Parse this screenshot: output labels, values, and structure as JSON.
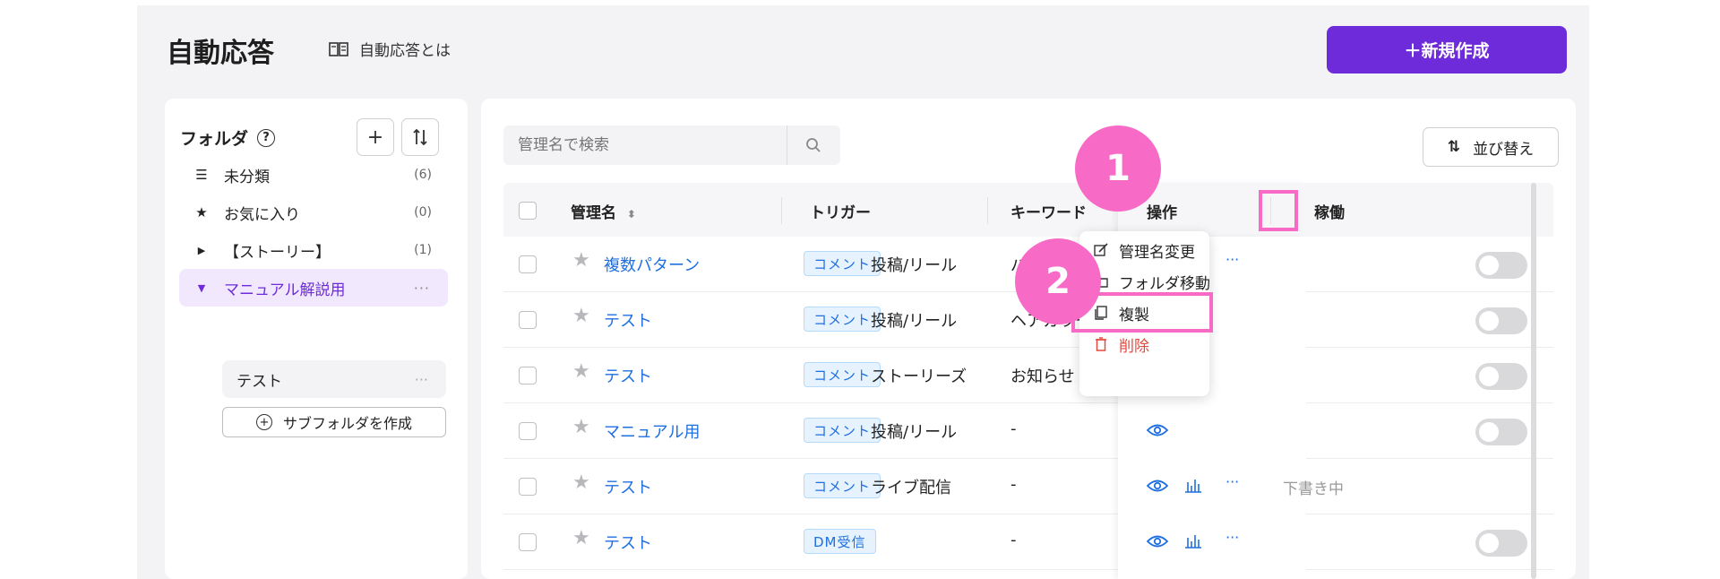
{
  "header": {
    "title": "自動応答",
    "help_link": "自動応答とは",
    "new_button": "＋新規作成"
  },
  "folders": {
    "heading": "フォルダ",
    "help_icon": "?",
    "items": [
      {
        "icon": "list-icon",
        "label": "未分類",
        "count": "(6)"
      },
      {
        "icon": "star-icon",
        "label": "お気に入り",
        "count": "(0)"
      },
      {
        "icon": "caret-right-icon",
        "label": "【ストーリー】",
        "count": "(1)"
      },
      {
        "icon": "caret-down-icon",
        "label": "マニュアル解説用",
        "more": "···"
      }
    ],
    "subfolder": {
      "label": "テスト",
      "more": "···"
    },
    "create_subfolder": "サブフォルダを作成"
  },
  "search": {
    "placeholder": "管理名で検索"
  },
  "sort_button": "並び替え",
  "table": {
    "headers": {
      "name": "管理名",
      "trigger": "トリガー",
      "keyword": "キーワード",
      "ops": "操作",
      "status": "稼働"
    },
    "rows": [
      {
        "name": "複数パターン",
        "badge": "コメント",
        "trigger": "投稿/リール",
        "keyword": "パン",
        "status": "toggle-off"
      },
      {
        "name": "テスト",
        "badge": "コメント",
        "trigger": "投稿/リール",
        "keyword": "ヘアカラー診断",
        "status": "toggle-off"
      },
      {
        "name": "テスト",
        "badge": "コメント",
        "trigger": "ストーリーズ",
        "keyword": "お知らせ",
        "status": "toggle-off"
      },
      {
        "name": "マニュアル用",
        "badge": "コメント",
        "trigger": "投稿/リール",
        "keyword": "-",
        "status": "toggle-off"
      },
      {
        "name": "テスト",
        "badge": "コメント",
        "trigger": "ライブ配信",
        "keyword": "-",
        "status": "下書き中"
      },
      {
        "name": "テスト",
        "badge": "DM受信",
        "trigger": "",
        "keyword": "-",
        "status": "toggle-off"
      }
    ]
  },
  "context_menu": {
    "items": [
      {
        "icon": "edit-icon",
        "label": "管理名変更"
      },
      {
        "icon": "folder-icon",
        "label": "フォルダ移動"
      },
      {
        "icon": "copy-icon",
        "label": "複製"
      },
      {
        "icon": "trash-icon",
        "label": "削除"
      }
    ]
  },
  "callouts": [
    "1",
    "2"
  ],
  "colors": {
    "accent": "#6e2bd9",
    "link": "#1f6fe0",
    "highlight": "#f76bc7",
    "danger": "#e5483e"
  }
}
